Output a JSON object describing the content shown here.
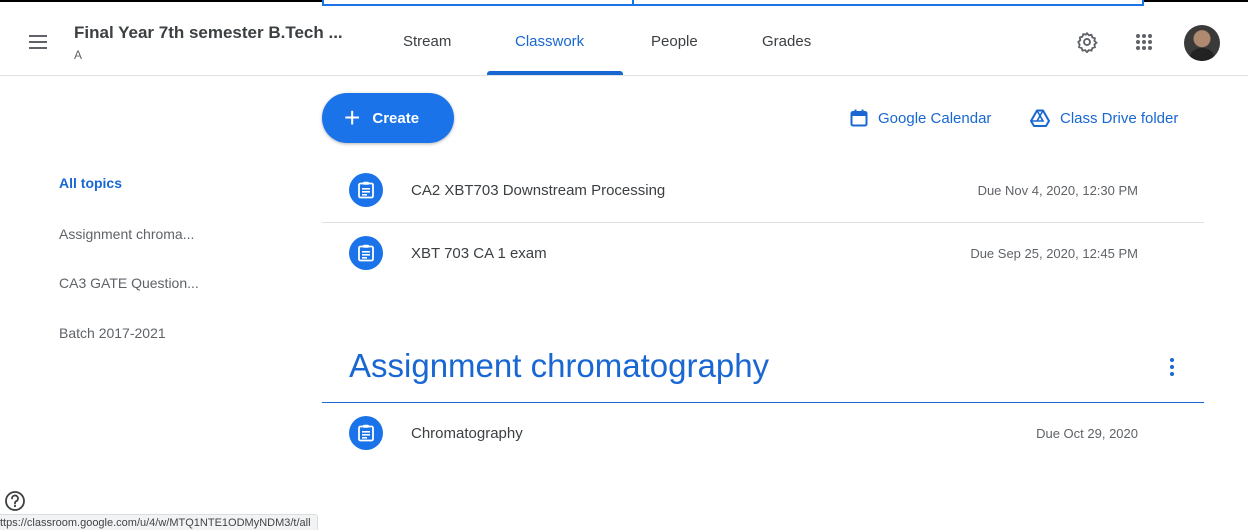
{
  "header": {
    "class_title": "Final Year 7th semester B.Tech ...",
    "class_section": "A",
    "tabs": [
      {
        "label": "Stream"
      },
      {
        "label": "Classwork"
      },
      {
        "label": "People"
      },
      {
        "label": "Grades"
      }
    ],
    "active_tab": "Classwork",
    "icons": [
      "menu-icon",
      "settings-icon",
      "apps-icon",
      "avatar"
    ]
  },
  "toolbar": {
    "create_label": "Create",
    "calendar_label": "Google Calendar",
    "drive_label": "Class Drive folder"
  },
  "sidebar": {
    "items": [
      {
        "label": "All topics"
      },
      {
        "label": "Assignment chroma..."
      },
      {
        "label": "CA3 GATE Question..."
      },
      {
        "label": "Batch 2017-2021"
      }
    ]
  },
  "classwork": {
    "items": [
      {
        "title": "CA2 XBT703 Downstream Processing",
        "due": "Due Nov 4, 2020, 12:30 PM"
      },
      {
        "title": "XBT 703 CA 1 exam",
        "due": "Due Sep 25, 2020, 12:45 PM"
      }
    ]
  },
  "topic": {
    "heading": "Assignment chromatography",
    "items": [
      {
        "title": "Chromatography",
        "due": "Due Oct 29, 2020"
      }
    ]
  },
  "status_bar": {
    "url": "ttps://classroom.google.com/u/4/w/MTQ1NTE1ODMyNDM3/t/all"
  },
  "colors": {
    "accent": "#1967d2",
    "button": "#1a73e8",
    "text": "#3c4043",
    "muted": "#5f6368"
  }
}
